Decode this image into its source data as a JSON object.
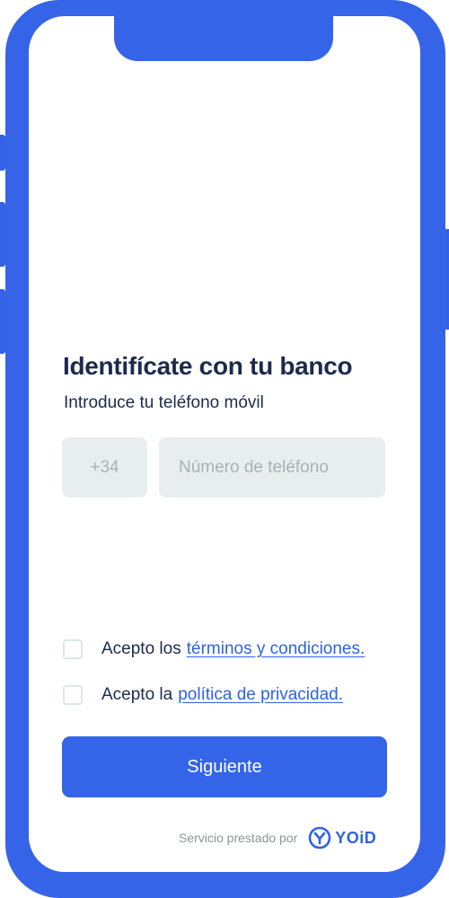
{
  "form": {
    "title": "Identifícate con tu banco",
    "subtitle": "Introduce tu teléfono móvil",
    "country_code": "+34",
    "phone_placeholder": "Número de teléfono",
    "phone_value": ""
  },
  "consents": [
    {
      "prefix": "Acepto los",
      "link": "términos y condiciones.",
      "checked": false
    },
    {
      "prefix": "Acepto la",
      "link": "política de privacidad.",
      "checked": false
    }
  ],
  "actions": {
    "next_label": "Siguiente"
  },
  "footer": {
    "text": "Servicio prestado por",
    "brand": "YOiD"
  },
  "colors": {
    "accent": "#3564e8",
    "link": "#2f62e2",
    "text": "#1d2a4d",
    "field_bg": "#e8eeee",
    "placeholder": "#a6b3b6"
  },
  "icons": {
    "brand_logo": "yoid-logo-icon"
  }
}
